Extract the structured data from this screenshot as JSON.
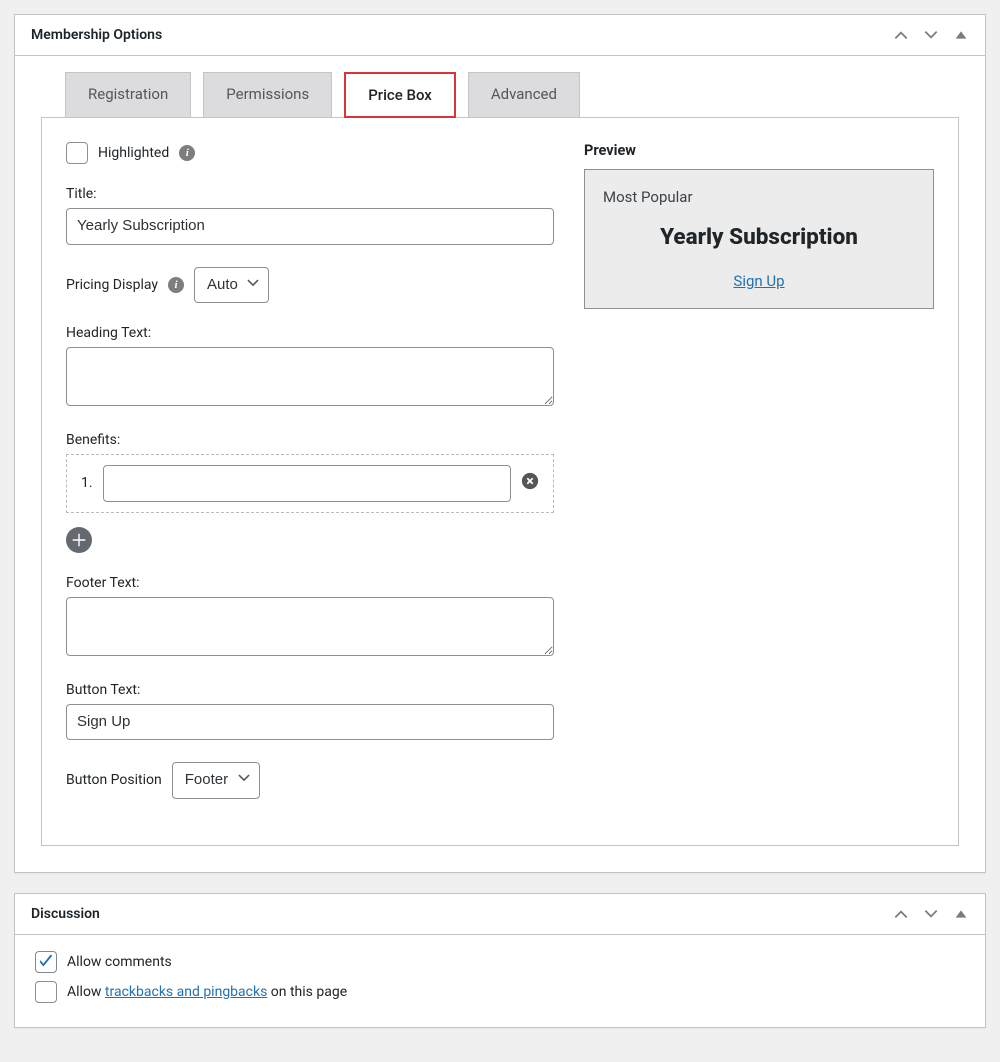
{
  "membership": {
    "panel_title": "Membership Options",
    "tabs": [
      "Registration",
      "Permissions",
      "Price Box",
      "Advanced"
    ],
    "active_tab": 2,
    "highlighted_label": "Highlighted",
    "highlighted_checked": false,
    "title_label": "Title:",
    "title_value": "Yearly Subscription",
    "pricing_display_label": "Pricing Display",
    "pricing_display_value": "Auto",
    "heading_text_label": "Heading Text:",
    "heading_text_value": "",
    "benefits_label": "Benefits:",
    "benefits": [
      ""
    ],
    "benefit_number_label": "1.",
    "footer_text_label": "Footer Text:",
    "footer_text_value": "",
    "button_text_label": "Button Text:",
    "button_text_value": "Sign Up",
    "button_position_label": "Button Position",
    "button_position_value": "Footer"
  },
  "preview": {
    "header": "Preview",
    "top": "Most Popular",
    "title": "Yearly Subscription",
    "link": "Sign Up"
  },
  "discussion": {
    "panel_title": "Discussion",
    "allow_comments_label": "Allow comments",
    "allow_comments_checked": true,
    "allow_trackbacks_pre": "Allow ",
    "allow_trackbacks_link": "trackbacks and pingbacks",
    "allow_trackbacks_post": " on this page",
    "allow_trackbacks_checked": false
  }
}
